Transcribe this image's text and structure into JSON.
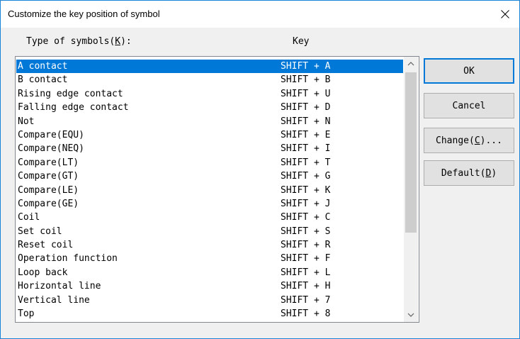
{
  "window": {
    "title": "Customize the key position of symbol"
  },
  "headers": {
    "type_label": "Type of symbols",
    "type_mnemonic": "K",
    "type_suffix": "):",
    "key_label": "Key"
  },
  "buttons": {
    "ok": {
      "label": "OK"
    },
    "cancel": {
      "label": "Cancel"
    },
    "change": {
      "label": "Change(",
      "mnemonic": "C",
      "suffix": ")..."
    },
    "default": {
      "label": "Default(",
      "mnemonic": "D",
      "suffix": ")"
    }
  },
  "symbols": [
    {
      "name": "A contact",
      "key": "SHIFT + A"
    },
    {
      "name": "B contact",
      "key": "SHIFT + B"
    },
    {
      "name": "Rising edge contact",
      "key": "SHIFT + U"
    },
    {
      "name": "Falling edge contact",
      "key": "SHIFT + D"
    },
    {
      "name": "Not",
      "key": "SHIFT + N"
    },
    {
      "name": "Compare(EQU)",
      "key": "SHIFT + E"
    },
    {
      "name": "Compare(NEQ)",
      "key": "SHIFT + I"
    },
    {
      "name": "Compare(LT)",
      "key": "SHIFT + T"
    },
    {
      "name": "Compare(GT)",
      "key": "SHIFT + G"
    },
    {
      "name": "Compare(LE)",
      "key": "SHIFT + K"
    },
    {
      "name": "Compare(GE)",
      "key": "SHIFT + J"
    },
    {
      "name": "Coil",
      "key": "SHIFT + C"
    },
    {
      "name": "Set coil",
      "key": "SHIFT + S"
    },
    {
      "name": "Reset coil",
      "key": "SHIFT + R"
    },
    {
      "name": "Operation function",
      "key": "SHIFT + F"
    },
    {
      "name": "Loop back",
      "key": "SHIFT + L"
    },
    {
      "name": "Horizontal line",
      "key": "SHIFT + H"
    },
    {
      "name": "Vertical line",
      "key": "SHIFT + 7"
    },
    {
      "name": "Top",
      "key": "SHIFT + 8"
    }
  ],
  "selected_index": 0,
  "icons": {
    "close": "close-icon",
    "scroll_up": "chevron-up-icon",
    "scroll_down": "chevron-down-icon"
  },
  "colors": {
    "selection": "#0078d7",
    "border_accent": "#1883d7"
  }
}
